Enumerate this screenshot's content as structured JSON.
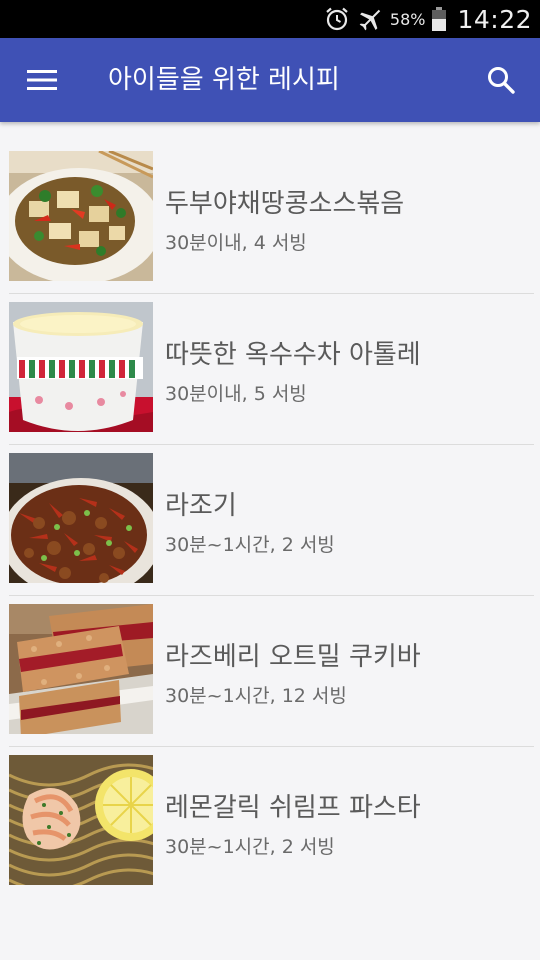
{
  "status_bar": {
    "battery_percent": "58%",
    "time": "14:22",
    "icons": [
      "alarm-icon",
      "airplane-mode-icon",
      "battery-icon"
    ]
  },
  "app_bar": {
    "title": "아이들을 위한 레시피",
    "icons": [
      "menu-icon",
      "search-icon"
    ],
    "color": "#3f51b5"
  },
  "recipes": [
    {
      "title": "두부야채땅콩소스볶음",
      "meta": "30분이내, 4 서빙",
      "image": "stir-fried-tofu-vegetables"
    },
    {
      "title": "따뜻한 옥수수차 아톨레",
      "meta": "30분이내, 5 서빙",
      "image": "corn-drink-cup"
    },
    {
      "title": "라조기",
      "meta": "30분~1시간, 2 서빙",
      "image": "spicy-chicken-chilies"
    },
    {
      "title": "라즈베리 오트밀 쿠키바",
      "meta": "30분~1시간, 12 서빙",
      "image": "raspberry-oatmeal-bars"
    },
    {
      "title": "레몬갈릭 쉬림프 파스타",
      "meta": "30분~1시간, 2 서빙",
      "image": "shrimp-pasta-lemon"
    }
  ]
}
